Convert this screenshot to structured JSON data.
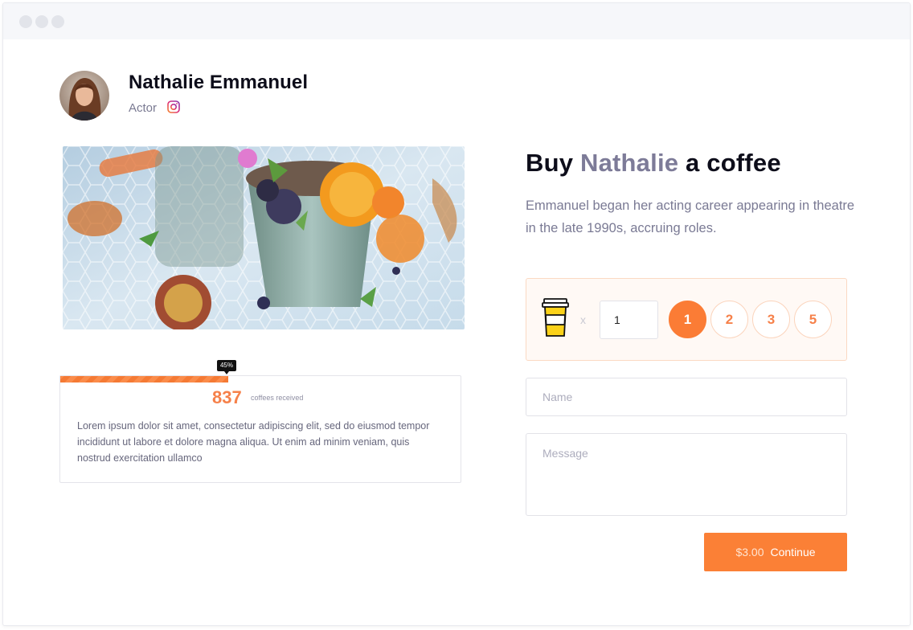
{
  "profile": {
    "name": "Nathalie Emmanuel",
    "role": "Actor",
    "social_icon": "instagram-icon"
  },
  "progress": {
    "percent_label": "45%",
    "percent": 45,
    "count": "837",
    "count_label": "coffees received"
  },
  "bio": "Lorem ipsum dolor sit amet, consectetur adipiscing elit, sed do eiusmod tempor incididunt ut labore et dolore magna aliqua. Ut enim ad minim veniam, quis nostrud exercitation ullamco",
  "support": {
    "heading_prefix": "Buy",
    "heading_highlight": "Nathalie",
    "heading_suffix": "a coffee",
    "description": "Emmanuel began her acting career appearing in theatre in the late 1990s, accruing roles.",
    "multiplier": "x",
    "quantity": "1",
    "options": [
      "1",
      "2",
      "3",
      "5"
    ],
    "selected_option": "1"
  },
  "form": {
    "name_placeholder": "Name",
    "message_placeholder": "Message",
    "price": "$3.00",
    "continue_label": "Continue"
  },
  "colors": {
    "accent": "#fb7c35",
    "highlight": "#7d7b98"
  }
}
